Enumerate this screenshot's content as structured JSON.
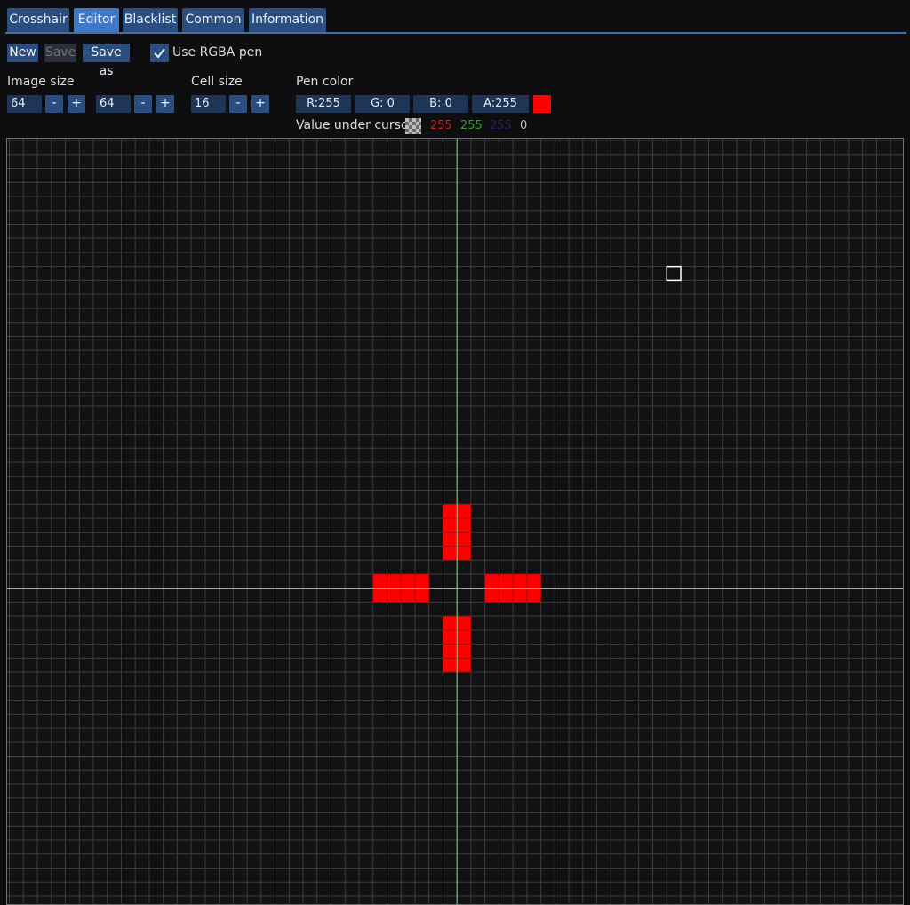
{
  "tabs": [
    {
      "label": "Crosshair",
      "active": false
    },
    {
      "label": "Editor",
      "active": true
    },
    {
      "label": "Blacklist",
      "active": false
    },
    {
      "label": "Common",
      "active": false
    },
    {
      "label": "Information",
      "active": false
    }
  ],
  "toolbar": {
    "new_label": "New",
    "save_label": "Save",
    "save_as_label": "Save as",
    "use_rgba_label": "Use RGBA pen",
    "use_rgba_checked": true
  },
  "image_size": {
    "label": "Image size",
    "width": "64",
    "height": "64",
    "minus": "-",
    "plus": "+"
  },
  "cell_size": {
    "label": "Cell size",
    "value": "16",
    "minus": "-",
    "plus": "+"
  },
  "pen_color": {
    "label": "Pen color",
    "r": "R:255",
    "g": "G:  0",
    "b": "B:  0",
    "a": "A:255",
    "swatch_color": "#ff0000"
  },
  "cursor_value": {
    "label": "Value under cursor",
    "r": "255",
    "g": "255",
    "b": "255",
    "a": "0",
    "r_color": "#c02020",
    "g_color": "#2fa02f",
    "b_color": "#20206a",
    "a_color": "#bdbdbd"
  },
  "colors": {
    "grid_line": "#3c3c3c",
    "center_line": "#8ecf8e",
    "pixel": "#ff0000",
    "pixel_border": "#9a1010"
  },
  "editor_grid": {
    "cursor_cell": [
      47,
      9
    ],
    "filled_cells": [
      [
        31,
        26
      ],
      [
        32,
        26
      ],
      [
        31,
        27
      ],
      [
        32,
        27
      ],
      [
        31,
        28
      ],
      [
        32,
        28
      ],
      [
        31,
        29
      ],
      [
        32,
        29
      ],
      [
        26,
        31
      ],
      [
        27,
        31
      ],
      [
        28,
        31
      ],
      [
        29,
        31
      ],
      [
        26,
        32
      ],
      [
        27,
        32
      ],
      [
        28,
        32
      ],
      [
        29,
        32
      ],
      [
        34,
        31
      ],
      [
        35,
        31
      ],
      [
        36,
        31
      ],
      [
        37,
        31
      ],
      [
        34,
        32
      ],
      [
        35,
        32
      ],
      [
        36,
        32
      ],
      [
        37,
        32
      ],
      [
        31,
        34
      ],
      [
        32,
        34
      ],
      [
        31,
        35
      ],
      [
        32,
        35
      ],
      [
        31,
        36
      ],
      [
        32,
        36
      ],
      [
        31,
        37
      ],
      [
        32,
        37
      ]
    ]
  }
}
